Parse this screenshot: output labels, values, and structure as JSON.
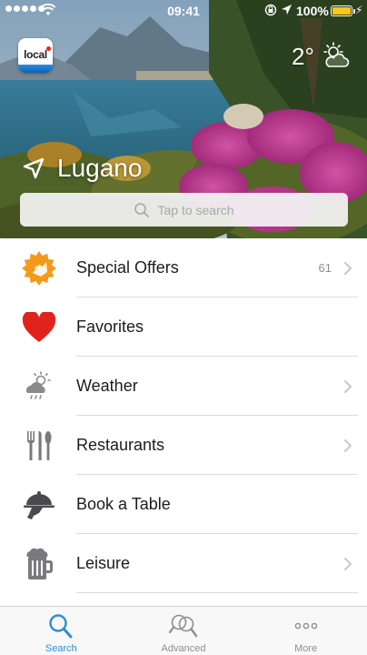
{
  "status_bar": {
    "time": "09:41",
    "battery_percent": "100%",
    "battery_level": 1.0
  },
  "header": {
    "app_logo_text": "local",
    "temperature": "2°",
    "weather_icon": "partly-cloudy-icon",
    "city": "Lugano",
    "location_icon": "location-arrow-icon"
  },
  "search": {
    "placeholder": "Tap to search"
  },
  "menu": {
    "items": [
      {
        "label": "Special Offers",
        "icon": "special-offers-badge-icon",
        "count": "61",
        "chevron": true
      },
      {
        "label": "Favorites",
        "icon": "heart-icon",
        "count": "",
        "chevron": false
      },
      {
        "label": "Weather",
        "icon": "weather-icon",
        "count": "",
        "chevron": true
      },
      {
        "label": "Restaurants",
        "icon": "fork-knife-icon",
        "count": "",
        "chevron": true
      },
      {
        "label": "Book a Table",
        "icon": "serving-cloche-icon",
        "count": "",
        "chevron": false
      },
      {
        "label": "Leisure",
        "icon": "beer-mug-icon",
        "count": "",
        "chevron": true
      }
    ]
  },
  "tab_bar": {
    "tabs": [
      {
        "label": "Search",
        "icon": "search-icon",
        "active": true
      },
      {
        "label": "Advanced",
        "icon": "advanced-search-icon",
        "active": false
      },
      {
        "label": "More",
        "icon": "more-dots-icon",
        "active": false
      }
    ]
  },
  "colors": {
    "accent": "#2a8fd4",
    "heart": "#e0241b",
    "offer_badge": "#f39a1c",
    "battery": "#f7c71b",
    "chevron": "#c7c7cc"
  }
}
